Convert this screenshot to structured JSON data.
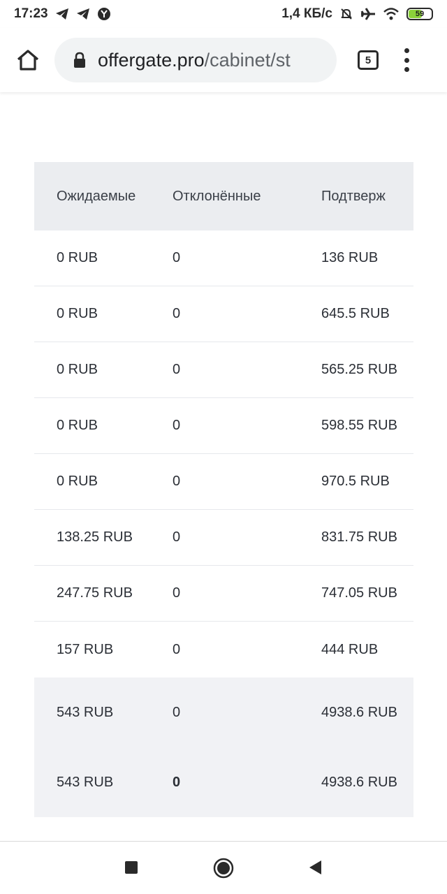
{
  "status_bar": {
    "time": "17:23",
    "net_speed": "1,4 КБ/с",
    "battery_level": "59",
    "battery_color": "#8bd13a"
  },
  "browser": {
    "url_domain": "offergate.pro",
    "url_path": "/cabinet/st",
    "tab_count": "5"
  },
  "table": {
    "headers": [
      "Ожидаемые",
      "Отклонённые",
      "Подтверж"
    ],
    "rows": [
      [
        "0 RUB",
        "0",
        "136 RUB"
      ],
      [
        "0 RUB",
        "0",
        "645.5 RUB"
      ],
      [
        "0 RUB",
        "0",
        "565.25 RUB"
      ],
      [
        "0 RUB",
        "0",
        "598.55 RUB"
      ],
      [
        "0 RUB",
        "0",
        "970.5 RUB"
      ],
      [
        "138.25 RUB",
        "0",
        "831.75 RUB"
      ],
      [
        "247.75 RUB",
        "0",
        "747.05 RUB"
      ],
      [
        "157 RUB",
        "0",
        "444 RUB"
      ]
    ],
    "totals": [
      [
        "543 RUB",
        "0",
        "4938.6 RUB"
      ],
      [
        "543 RUB",
        "0",
        "4938.6 RUB"
      ]
    ]
  }
}
